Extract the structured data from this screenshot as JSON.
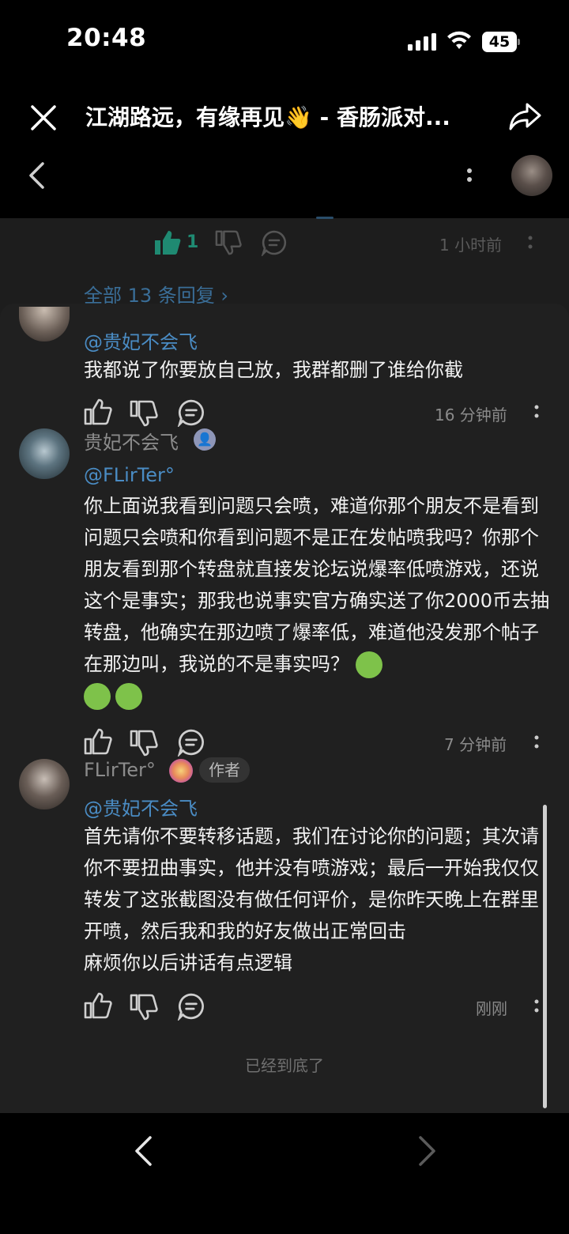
{
  "status_bar": {
    "time": "20:48",
    "battery": "45"
  },
  "header": {
    "title": "江湖路远，有缘再见👋 - 香肠派对..."
  },
  "top_comment_actions": {
    "like_count": "1",
    "time": "1 小时前"
  },
  "replies_link": "全部 13 条回复 ›",
  "comments": [
    {
      "mention": "@贵妃不会飞",
      "text": "我都说了你要放自己放，我群都删了谁给你截",
      "time": "16 分钟前"
    },
    {
      "username": "贵妃不会飞",
      "mention": "@FLirTer°",
      "text": "你上面说我看到问题只会喷，难道你那个朋友不是看到问题只会喷和你看到问题不是正在发帖喷我吗？你那个朋友看到那个转盘就直接发论坛说爆率低喷游戏，还说这个是事实；那我也说事实官方确实送了你2000币去抽转盘，他确实在那边喷了爆率低，难道他没发那个帖子在那边叫，我说的不是事实吗？",
      "time": "7 分钟前"
    },
    {
      "username": "FLirTer°",
      "badge": "作者",
      "mention": "@贵妃不会飞",
      "text": "首先请你不要转移话题，我们在讨论你的问题；其次请你不要扭曲事实，他并没有喷游戏；最后一开始我仅仅转发了这张截图没有做任何评价，是你昨天晚上在群里开喷，然后我和我的好友做出正常回击\n麻烦你以后讲话有点逻辑",
      "time": "刚刚"
    }
  ],
  "end_text": "已经到底了",
  "colors": {
    "accent_green": "#1fa88a",
    "link_blue": "#4a8cc4"
  }
}
